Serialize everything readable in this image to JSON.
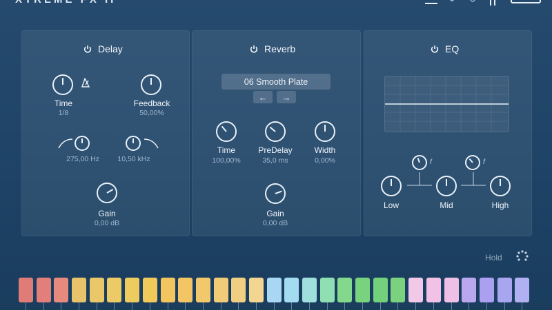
{
  "app": {
    "brand": "XTREME FX II"
  },
  "delay": {
    "title": "Delay",
    "time_label": "Time",
    "time_value": "1/8",
    "feedback_label": "Feedback",
    "feedback_value": "50,00%",
    "lowcut_value": "275,00 Hz",
    "highcut_value": "10,50 kHz",
    "gain_label": "Gain",
    "gain_value": "0,00 dB"
  },
  "reverb": {
    "title": "Reverb",
    "preset": "06 Smooth Plate",
    "prev_label": "←",
    "next_label": "→",
    "time_label": "Time",
    "time_value": "100,00%",
    "predelay_label": "PreDelay",
    "predelay_value": "35,0 ms",
    "width_label": "Width",
    "width_value": "0,00%",
    "gain_label": "Gain",
    "gain_value": "0,00 dB"
  },
  "eq": {
    "title": "EQ",
    "low_label": "Low",
    "mid_label": "Mid",
    "high_label": "High",
    "freq_symbol": "f"
  },
  "footer": {
    "hold_label": "Hold"
  },
  "colors": {
    "accent": "#e9f1f8",
    "panel_bg": "#2c5073",
    "value_text": "#9fb8cf"
  },
  "key_colors": [
    "#e07c78",
    "#e27f7a",
    "#e58a7c",
    "#e8c36a",
    "#eac86a",
    "#ecca66",
    "#eecb5e",
    "#f1c95a",
    "#f2c55e",
    "#f3c565",
    "#f2c86d",
    "#f1cb78",
    "#f0cf82",
    "#f2d591",
    "#a8d6f3",
    "#a3dcf0",
    "#9fe0de",
    "#8fdfb3",
    "#83d88e",
    "#79d27e",
    "#73d07b",
    "#7ad17e",
    "#f2c8e8",
    "#f2c2e6",
    "#eec0e6",
    "#b9a8f0",
    "#ab9ff0",
    "#a9a6f0",
    "#b0b0f2"
  ]
}
